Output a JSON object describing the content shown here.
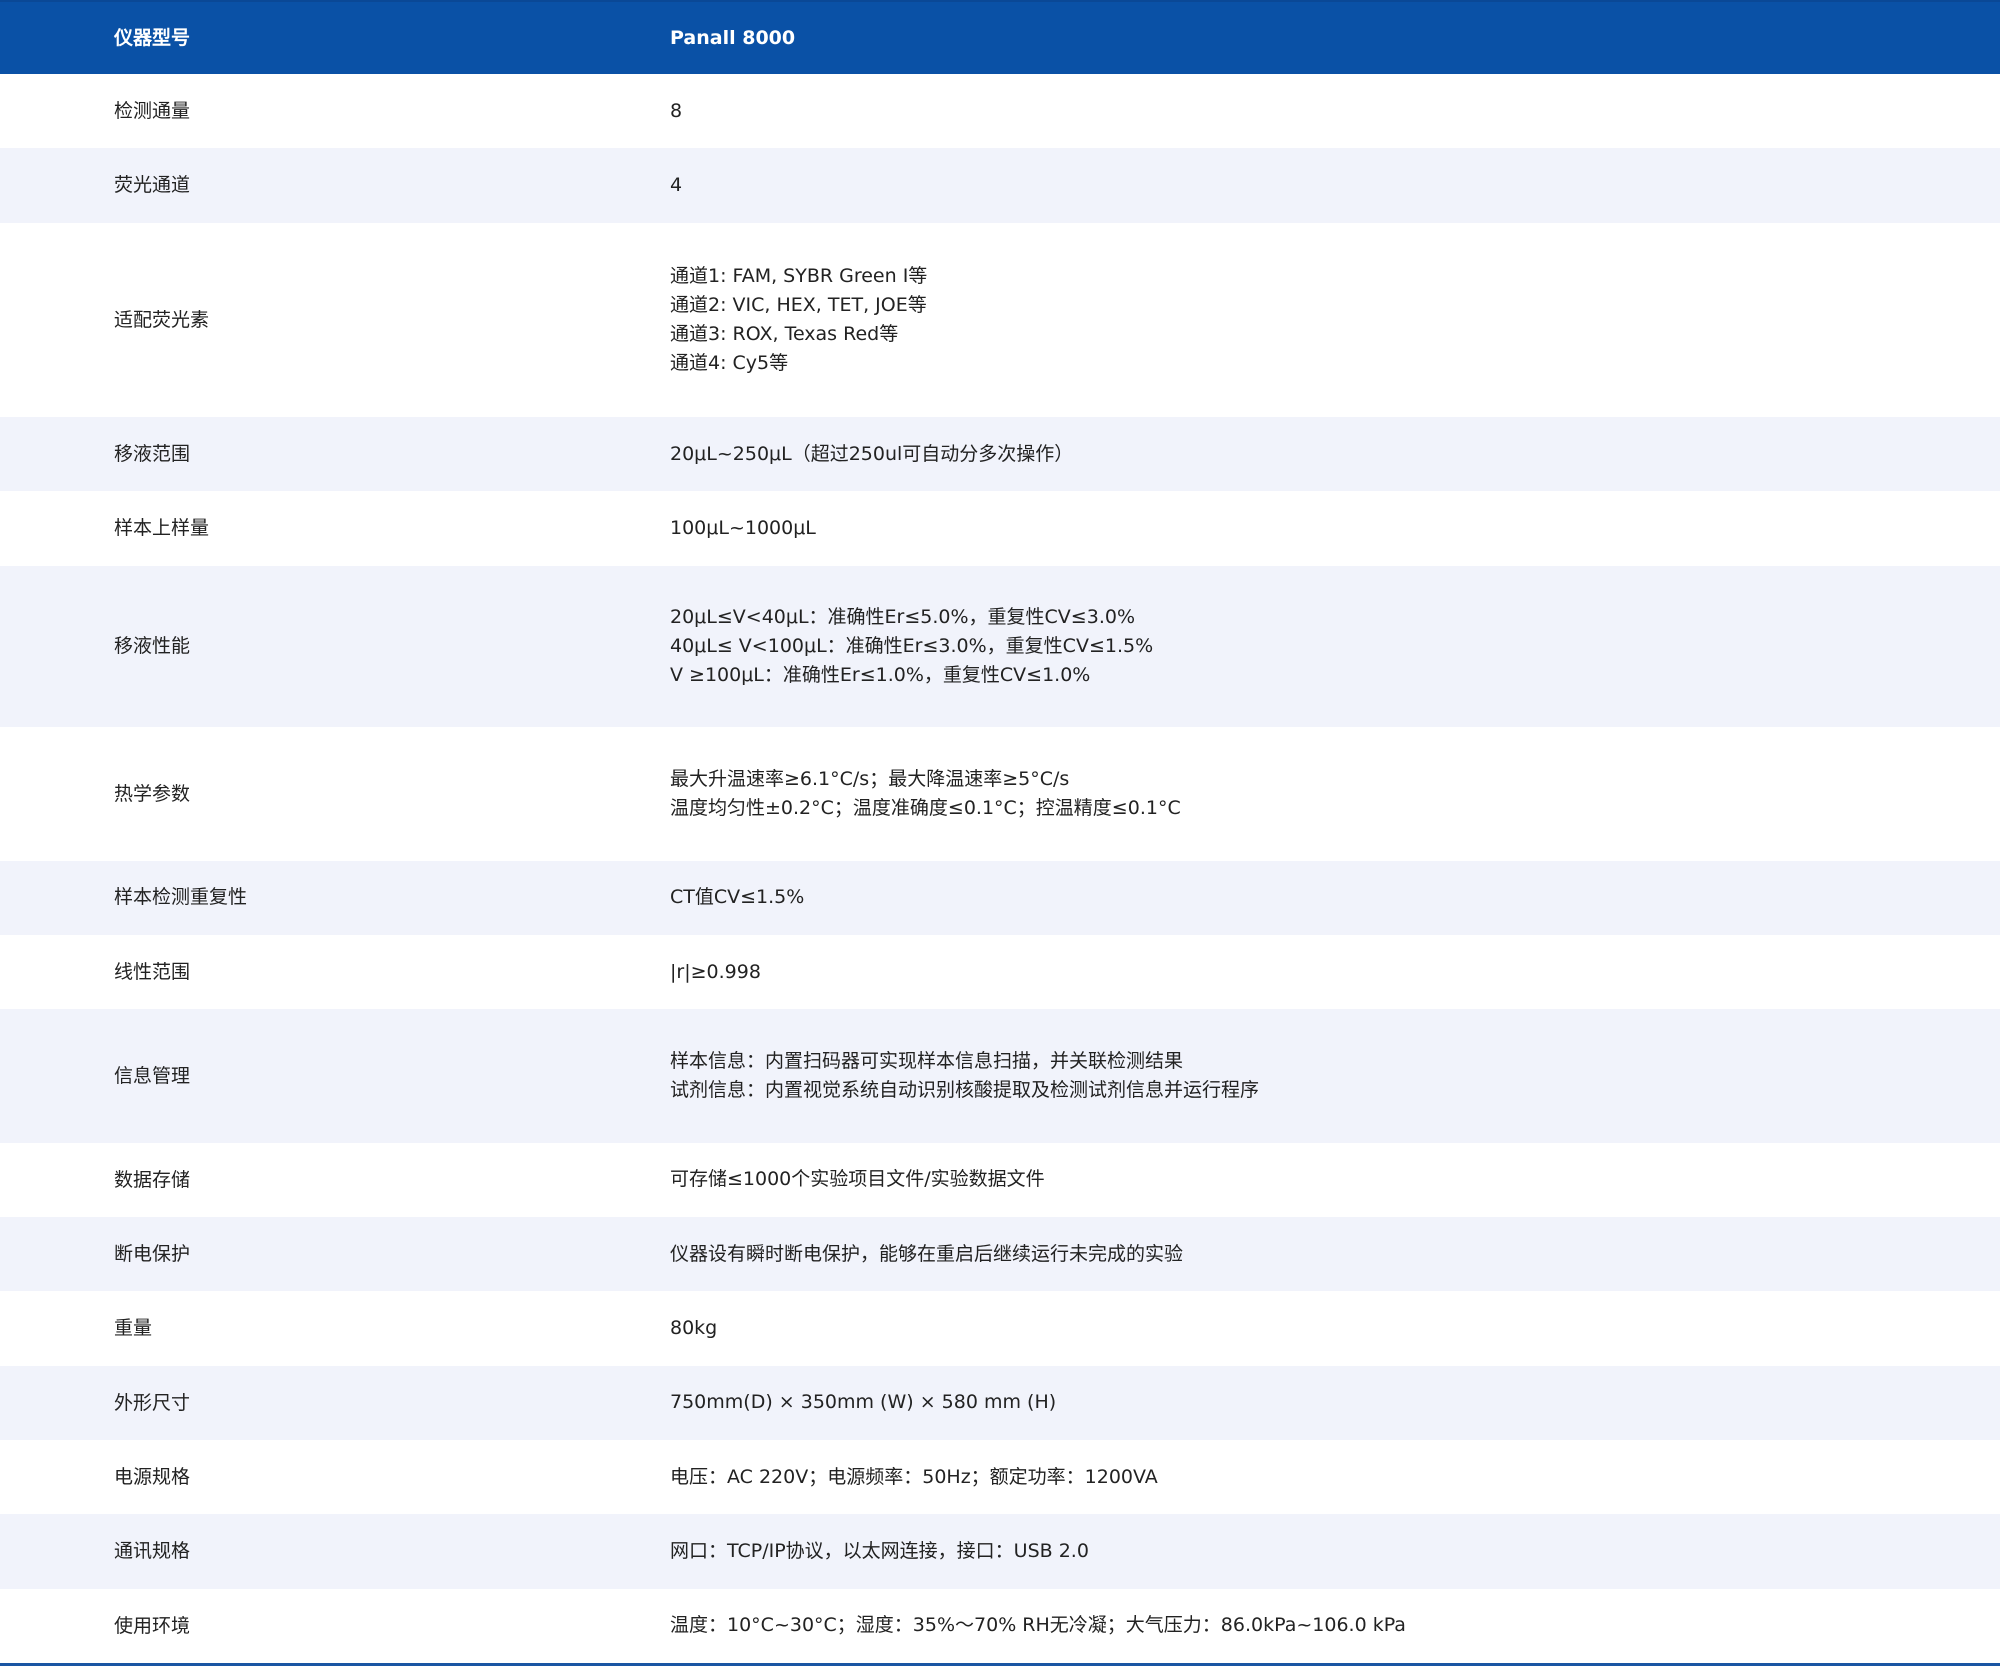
{
  "header": {
    "key": "仪器型号",
    "value": "Panall 8000"
  },
  "rows": [
    {
      "key": "检测通量",
      "lines": [
        "8"
      ]
    },
    {
      "key": "荧光通道",
      "lines": [
        "4"
      ]
    },
    {
      "key": "适配荧光素",
      "lines": [
        "通道1: FAM, SYBR Green I等",
        "通道2: VIC, HEX, TET, JOE等",
        "通道3: ROX, Texas Red等",
        "通道4: Cy5等"
      ]
    },
    {
      "key": "移液范围",
      "lines": [
        "20μL~250μL（超过250ul可自动分多次操作）"
      ]
    },
    {
      "key": "样本上样量",
      "lines": [
        "100μL~1000μL"
      ]
    },
    {
      "key": "移液性能",
      "lines": [
        "20μL≤V<40μL：准确性Er≤5.0%，重复性CV≤3.0%",
        "40μL≤ V<100μL：准确性Er≤3.0%，重复性CV≤1.5%",
        "V ≥100μL：准确性Er≤1.0%，重复性CV≤1.0%"
      ]
    },
    {
      "key": "热学参数",
      "lines": [
        "最大升温速率≥6.1°C/s；最大降温速率≥5°C/s",
        "温度均匀性±0.2°C；温度准确度≤0.1°C；控温精度≤0.1°C"
      ]
    },
    {
      "key": "样本检测重复性",
      "lines": [
        "CT值CV≤1.5%"
      ]
    },
    {
      "key": "线性范围",
      "lines": [
        "|r|≥0.998"
      ]
    },
    {
      "key": "信息管理",
      "lines": [
        "样本信息：内置扫码器可实现样本信息扫描，并关联检测结果",
        "试剂信息：内置视觉系统自动识别核酸提取及检测试剂信息并运行程序"
      ]
    },
    {
      "key": "数据存储",
      "lines": [
        "可存储≤1000个实验项目文件/实验数据文件"
      ]
    },
    {
      "key": "断电保护",
      "lines": [
        "仪器设有瞬时断电保护，能够在重启后继续运行未完成的实验"
      ]
    },
    {
      "key": "重量",
      "lines": [
        "80kg"
      ]
    },
    {
      "key": "外形尺寸",
      "lines": [
        "750mm(D) × 350mm (W) × 580 mm (H)"
      ]
    },
    {
      "key": "电源规格",
      "lines": [
        "电压：AC 220V；电源频率：50Hz；额定功率：1200VA"
      ]
    },
    {
      "key": "通讯规格",
      "lines": [
        "网口：TCP/IP协议，以太网连接，接口：USB 2.0"
      ]
    },
    {
      "key": "使用环境",
      "lines": [
        "温度：10°C~30°C；湿度：35%～70% RH无冷凝；大气压力：86.0kPa~106.0 kPa"
      ]
    }
  ]
}
